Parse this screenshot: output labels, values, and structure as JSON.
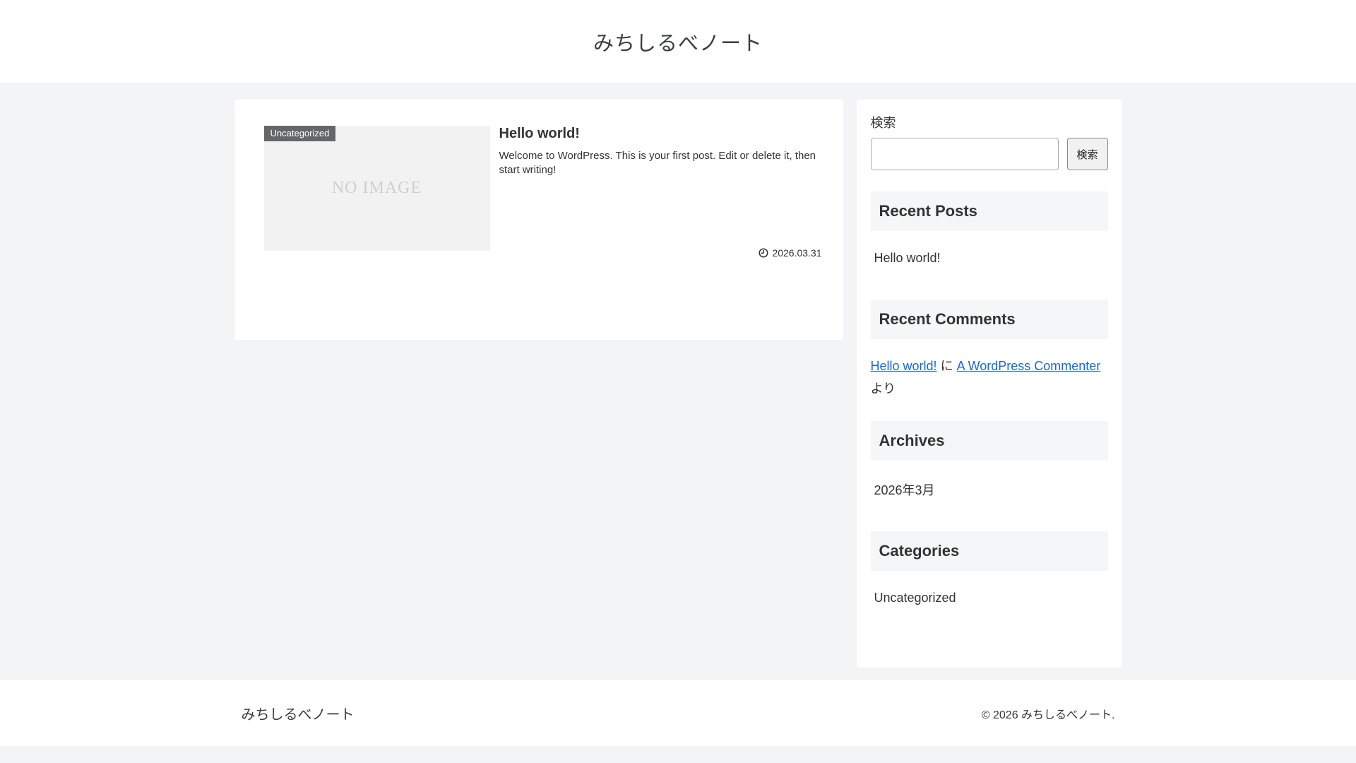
{
  "colors": {
    "page_bg": "#f3f4f6",
    "card_bg": "#ffffff",
    "widget_heading_bg": "#f5f6f7",
    "badge_bg": "#656667",
    "link_blue": "#1967d2",
    "text": "#333333"
  },
  "header": {
    "site_title": "みちしるべノート"
  },
  "post": {
    "category_badge": "Uncategorized",
    "no_image_text": "NO IMAGE",
    "title": "Hello world!",
    "excerpt": "Welcome to WordPress. This is your first post. Edit or delete it, then start writing!",
    "date": "2026.03.31"
  },
  "sidebar": {
    "search_label": "検索",
    "search_button": "検索",
    "search_value": "",
    "recent_posts": {
      "heading": "Recent Posts",
      "items": [
        {
          "label": "Hello world!"
        }
      ]
    },
    "recent_comments": {
      "heading": "Recent Comments",
      "post_link": "Hello world!",
      "connector": "に",
      "author_link": "A WordPress Commenter",
      "suffix": "より"
    },
    "archives": {
      "heading": "Archives",
      "items": [
        {
          "label": "2026年3月"
        }
      ]
    },
    "categories": {
      "heading": "Categories",
      "items": [
        {
          "label": "Uncategorized"
        }
      ]
    }
  },
  "footer": {
    "logo": "みちしるべノート",
    "copyright": "© 2026 みちしるべノート."
  }
}
